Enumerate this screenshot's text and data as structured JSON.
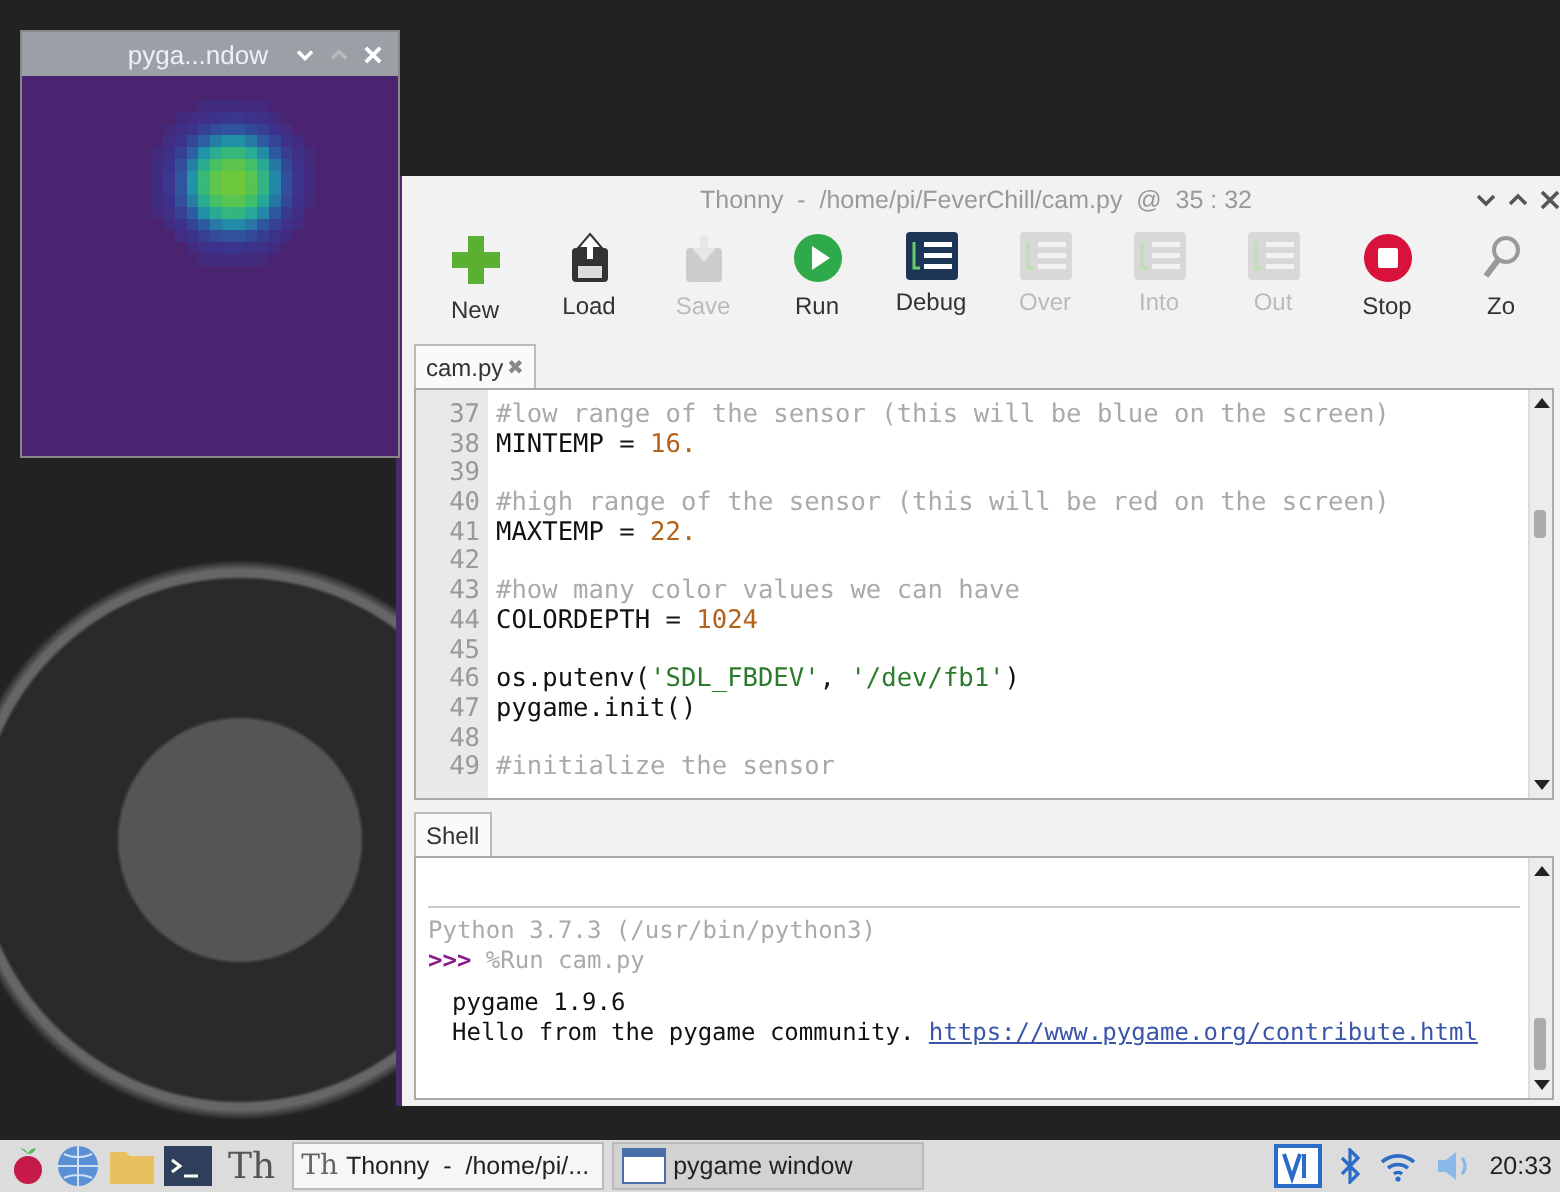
{
  "pygame_window": {
    "title": "pyga...ndow"
  },
  "thonny_window": {
    "title": "Thonny  -  /home/pi/FeverChill/cam.py  @  35 : 32",
    "toolbar": [
      {
        "kind": "new",
        "label": "New",
        "disabled": false
      },
      {
        "kind": "load",
        "label": "Load",
        "disabled": false
      },
      {
        "kind": "save",
        "label": "Save",
        "disabled": true
      },
      {
        "kind": "run",
        "label": "Run",
        "disabled": false
      },
      {
        "kind": "debug",
        "label": "Debug",
        "disabled": false
      },
      {
        "kind": "over",
        "label": "Over",
        "disabled": true
      },
      {
        "kind": "into",
        "label": "Into",
        "disabled": true
      },
      {
        "kind": "out",
        "label": "Out",
        "disabled": true
      },
      {
        "kind": "stop",
        "label": "Stop",
        "disabled": false
      },
      {
        "kind": "zoom",
        "label": "Zo",
        "disabled": false
      }
    ],
    "editor_tab": {
      "label": "cam.py",
      "close": "✖",
      "selected": true
    },
    "code_lines": [
      {
        "number": "37",
        "segments": [
          {
            "kind": "comment",
            "text": "#low range of the sensor (this will be blue on the screen)"
          }
        ]
      },
      {
        "number": "38",
        "segments": [
          {
            "kind": "code",
            "text": "MINTEMP = "
          },
          {
            "kind": "number",
            "text": "16."
          }
        ]
      },
      {
        "number": "39"
      },
      {
        "number": "40",
        "segments": [
          {
            "kind": "comment",
            "text": "#high range of the sensor (this will be red on the screen)"
          }
        ]
      },
      {
        "number": "41",
        "segments": [
          {
            "kind": "code",
            "text": "MAXTEMP = "
          },
          {
            "kind": "number",
            "text": "22."
          }
        ]
      },
      {
        "number": "42"
      },
      {
        "number": "43",
        "segments": [
          {
            "kind": "comment",
            "text": "#how many color values we can have"
          }
        ]
      },
      {
        "number": "44",
        "segments": [
          {
            "kind": "code",
            "text": "COLORDEPTH = "
          },
          {
            "kind": "number",
            "text": "1024"
          }
        ]
      },
      {
        "number": "45"
      },
      {
        "number": "46",
        "segments": [
          {
            "kind": "code",
            "text": "os.putenv("
          },
          {
            "kind": "string",
            "text": "'SDL_FBDEV'"
          },
          {
            "kind": "code",
            "text": ", "
          },
          {
            "kind": "string",
            "text": "'/dev/fb1'"
          },
          {
            "kind": "code",
            "text": ")"
          }
        ]
      },
      {
        "number": "47",
        "segments": [
          {
            "kind": "code",
            "text": "pygame.init()"
          }
        ]
      },
      {
        "number": "48"
      },
      {
        "number": "49",
        "segments": [
          {
            "kind": "comment",
            "text": "#initialize the sensor"
          }
        ]
      }
    ],
    "shell_tab": {
      "label": "Shell",
      "selected": true
    },
    "shell_lines": [
      {
        "kind": "banner",
        "text": "Python 3.7.3 (/usr/bin/python3)"
      },
      {
        "kind": "prompt",
        "prompt": ">>>",
        "text": "%Run cam.py"
      },
      {
        "kind": "output",
        "text": "pygame 1.9.6"
      },
      {
        "kind": "output",
        "text": "Hello from the pygame community.",
        "link": "https://www.pygame.org/contribute.html"
      }
    ]
  },
  "taskbar": {
    "launcher": {
      "label": "Th"
    },
    "tasks": [
      {
        "kind": "thonny",
        "icon": "Th",
        "label": "Thonny  -  /home/pi/...",
        "selected": true
      },
      {
        "kind": "window",
        "label": "pygame window",
        "selected": false
      }
    ],
    "clock": "20:33"
  }
}
